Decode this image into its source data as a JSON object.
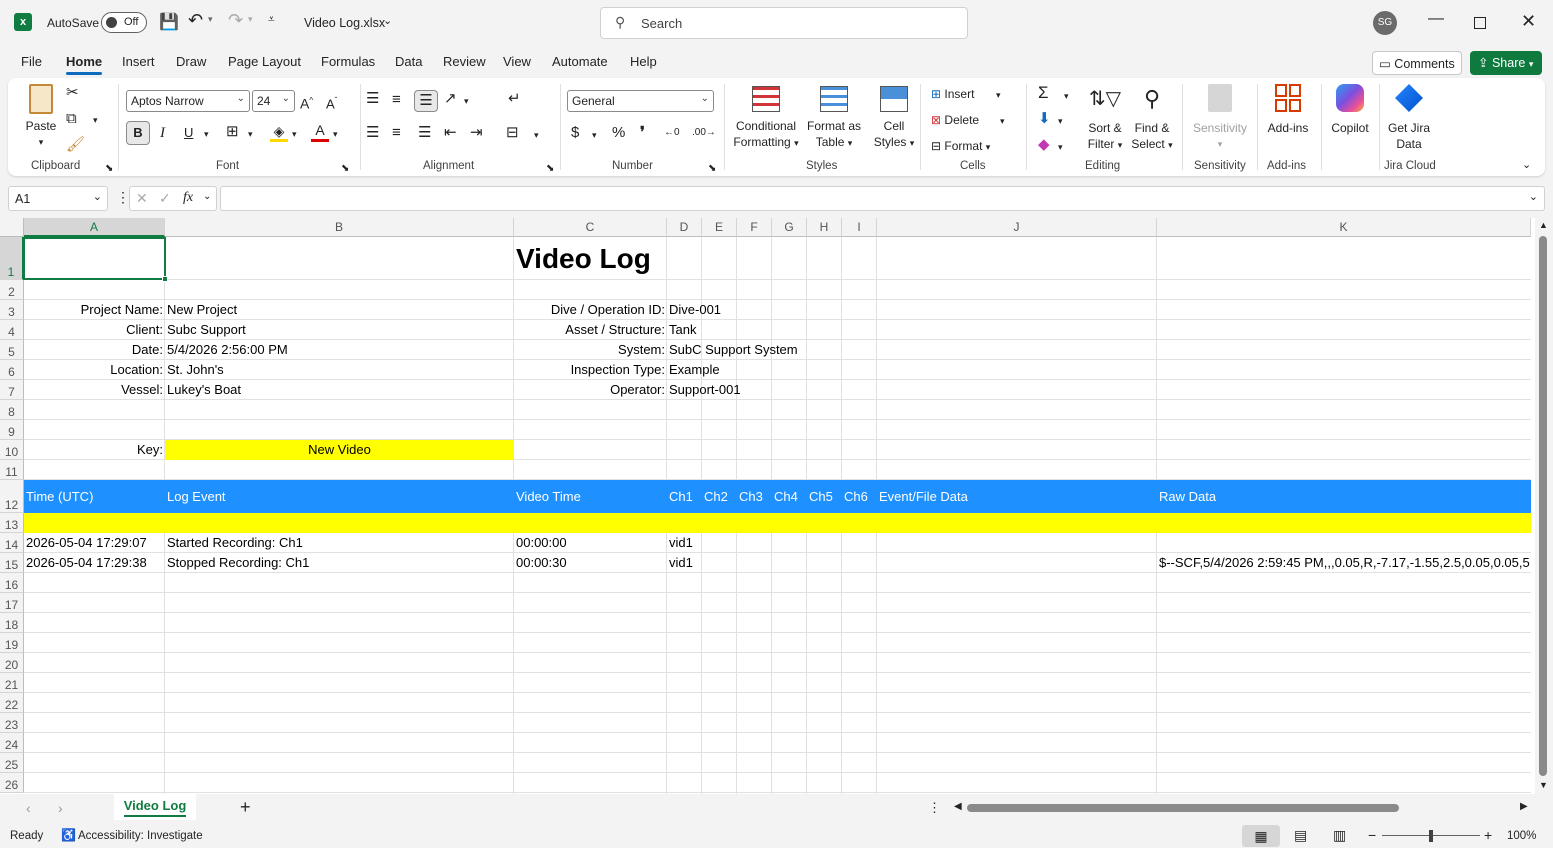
{
  "titlebar": {
    "autosave_label": "AutoSave",
    "autosave_state": "Off",
    "file_name": "Video Log.xlsx",
    "search_placeholder": "Search",
    "user_initials": "SG"
  },
  "tabs": [
    "File",
    "Home",
    "Insert",
    "Draw",
    "Page Layout",
    "Formulas",
    "Data",
    "Review",
    "View",
    "Automate",
    "Help"
  ],
  "active_tab": "Home",
  "right_buttons": {
    "comments": "Comments",
    "share": "Share"
  },
  "ribbon": {
    "clipboard": {
      "paste": "Paste",
      "label": "Clipboard"
    },
    "font": {
      "name": "Aptos Narrow",
      "size": "24",
      "label": "Font"
    },
    "alignment": {
      "label": "Alignment"
    },
    "number": {
      "format": "General",
      "label": "Number"
    },
    "styles": {
      "conditional_1": "Conditional",
      "conditional_2": "Formatting",
      "format_table_1": "Format as",
      "format_table_2": "Table",
      "cell_styles_1": "Cell",
      "cell_styles_2": "Styles",
      "label": "Styles"
    },
    "cells": {
      "insert": "Insert",
      "delete": "Delete",
      "format": "Format",
      "label": "Cells"
    },
    "editing": {
      "sort_1": "Sort &",
      "sort_2": "Filter",
      "find_1": "Find &",
      "find_2": "Select",
      "label": "Editing"
    },
    "sensitivity": {
      "button": "Sensitivity",
      "label": "Sensitivity"
    },
    "addins": {
      "button": "Add-ins",
      "label": "Add-ins"
    },
    "copilot": {
      "button": "Copilot"
    },
    "jira": {
      "button_1": "Get Jira",
      "button_2": "Data",
      "label": "Jira Cloud"
    }
  },
  "formula_bar": {
    "name_box": "A1",
    "fx": "fx",
    "formula": ""
  },
  "columns": [
    "A",
    "B",
    "C",
    "D",
    "E",
    "F",
    "G",
    "H",
    "I",
    "J",
    "K"
  ],
  "rows": [
    "1",
    "2",
    "3",
    "4",
    "5",
    "6",
    "7",
    "8",
    "9",
    "10",
    "11",
    "12",
    "13",
    "14",
    "15",
    "16",
    "17",
    "18",
    "19",
    "20",
    "21",
    "22",
    "23",
    "24",
    "25",
    "26"
  ],
  "sheet": {
    "title": "Video Log",
    "info_left": [
      {
        "label": "Project Name:",
        "value": "New Project"
      },
      {
        "label": "Client:",
        "value": "Subc Support"
      },
      {
        "label": "Date:",
        "value": "5/4/2026 2:56:00 PM"
      },
      {
        "label": "Location:",
        "value": "St. John's"
      },
      {
        "label": "Vessel:",
        "value": "Lukey's Boat"
      }
    ],
    "info_right": [
      {
        "label": "Dive / Operation ID:",
        "value": "Dive-001"
      },
      {
        "label": "Asset / Structure:",
        "value": "Tank"
      },
      {
        "label": "System:",
        "value": "SubC Support System"
      },
      {
        "label": "Inspection Type:",
        "value": "Example"
      },
      {
        "label": "Operator:",
        "value": "Support-001"
      }
    ],
    "key_label": "Key:",
    "key_value": "New Video",
    "headers": [
      "Time (UTC)",
      "Log Event",
      "Video Time",
      "Ch1",
      "Ch2",
      "Ch3",
      "Ch4",
      "Ch5",
      "Ch6",
      "Event/File Data",
      "Raw Data"
    ],
    "data_rows": [
      {
        "time": "2026-05-04 17:29:07",
        "event": "Started Recording: Ch1",
        "video_time": "00:00:00",
        "ch1": "vid1",
        "raw": ""
      },
      {
        "time": "2026-05-04 17:29:38",
        "event": "Stopped Recording: Ch1",
        "video_time": "00:00:30",
        "ch1": "vid1",
        "raw": "$--SCF,5/4/2026 2:59:45 PM,,,0.05,R,-7.17,-1.55,2.5,0.05,0.05,5"
      }
    ],
    "colors": {
      "header_fill": "#1e90ff",
      "highlight_fill": "#ffff00"
    }
  },
  "sheet_tabs": [
    "Video Log"
  ],
  "status": {
    "ready": "Ready",
    "accessibility": "Accessibility: Investigate",
    "zoom": "100%"
  }
}
